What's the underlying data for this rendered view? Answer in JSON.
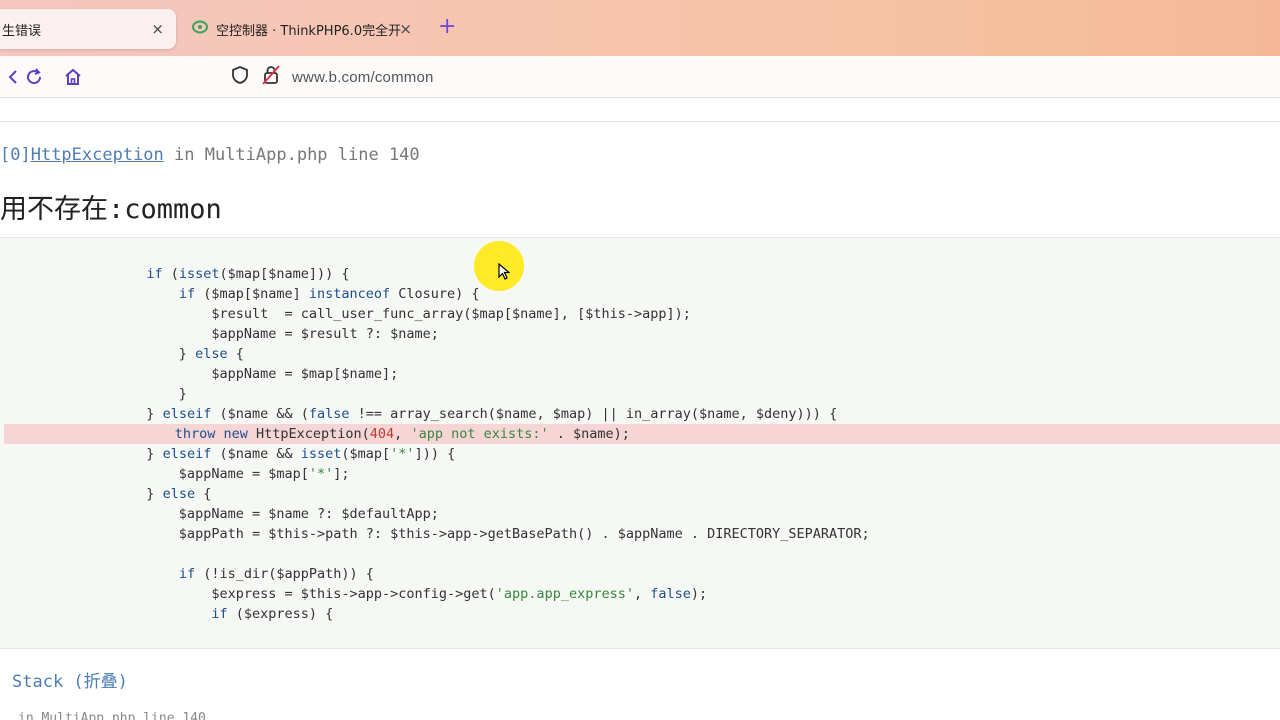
{
  "browser": {
    "tabs": [
      {
        "title": "生错误",
        "active": true
      },
      {
        "title": "空控制器 · ThinkPHP6.0完全开",
        "active": false
      }
    ],
    "new_tab_label": "+",
    "close_glyph": "×",
    "url": "www.b.com/common"
  },
  "error": {
    "exception_prefix": "[0]",
    "exception_class": "HttpException",
    "exception_location": " in MultiApp.php line 140",
    "message": "用不存在:common"
  },
  "source_lines": [
    "        if (isset($map[$name])) {",
    "            if ($map[$name] instanceof Closure) {",
    "                $result  = call_user_func_array($map[$name], [$this->app]);",
    "                $appName = $result ?: $name;",
    "            } else {",
    "                $appName = $map[$name];",
    "            }",
    "        } elseif ($name && (false !== array_search($name, $map) || in_array($name, $deny))) {",
    "            throw new HttpException(404, 'app not exists:' . $name);",
    "        } elseif ($name && isset($map['*'])) {",
    "            $appName = $map['*'];",
    "        } else {",
    "            $appName = $name ?: $defaultApp;",
    "            $appPath = $this->path ?: $this->app->getBasePath() . $appName . DIRECTORY_SEPARATOR;",
    "",
    "            if (!is_dir($appPath)) {",
    "                $express = $this->app->config->get('app.app_express', false);",
    "                if ($express) {"
  ],
  "highlight_line_index": 8,
  "stack": {
    "title": "Stack (折叠)",
    "first_entry": "in MultiApp.php line 140"
  },
  "colors": {
    "highlight_bg": "#f5d5d6",
    "link": "#4e7db5",
    "cursor_highlight": "#ffe900"
  }
}
